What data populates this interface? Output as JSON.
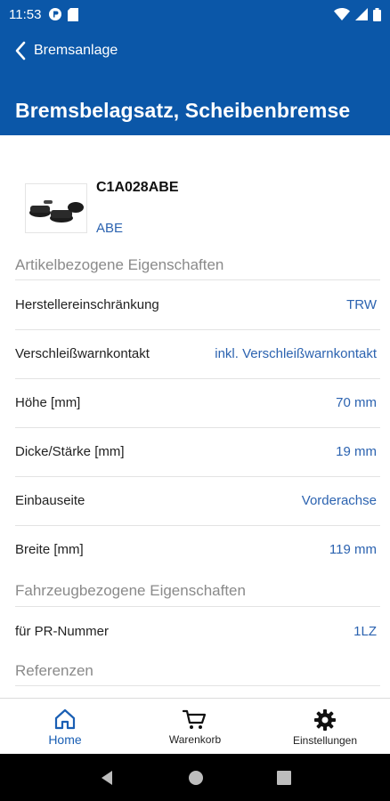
{
  "status_bar": {
    "time": "11:53"
  },
  "header": {
    "back_label": "Bremsanlage",
    "title": "Bremsbelagsatz, Scheibenbremse"
  },
  "article": {
    "number": "C1A028ABE",
    "brand": "ABE"
  },
  "sections": {
    "article_props_heading": "Artikelbezogene Eigenschaften",
    "vehicle_props_heading": "Fahrzeugbezogene Eigenschaften",
    "references_heading": "Referenzen"
  },
  "article_props": [
    {
      "label": "Herstellereinschränkung",
      "value": "TRW"
    },
    {
      "label": "Verschleißwarnkontakt",
      "value": "inkl. Verschleißwarnkontakt"
    },
    {
      "label": "Höhe [mm]",
      "value": "70 mm"
    },
    {
      "label": "Dicke/Stärke [mm]",
      "value": "19 mm"
    },
    {
      "label": "Einbauseite",
      "value": "Vorderachse"
    },
    {
      "label": "Breite [mm]",
      "value": "119 mm"
    }
  ],
  "vehicle_props": [
    {
      "label": "für PR-Nummer",
      "value": "1LZ"
    }
  ],
  "bottom_nav": [
    {
      "label": "Home",
      "icon": "home-icon",
      "active": true
    },
    {
      "label": "Warenkorb",
      "icon": "cart-icon",
      "active": false
    },
    {
      "label": "Einstellungen",
      "icon": "gear-icon",
      "active": false
    }
  ],
  "colors": {
    "primary": "#0b57a8",
    "link": "#2c63b0",
    "active_nav": "#1a5fb4"
  }
}
